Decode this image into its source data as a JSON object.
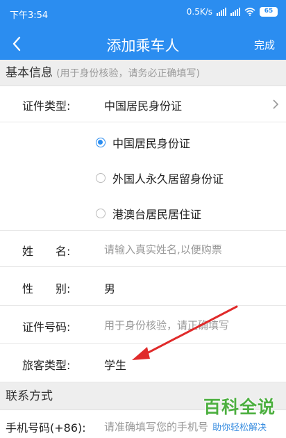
{
  "status_bar": {
    "time": "下午3:54",
    "speed": "0.5K/s",
    "battery": "65"
  },
  "nav": {
    "title": "添加乘车人",
    "done": "完成"
  },
  "basic_section": {
    "title": "基本信息",
    "hint": "(用于身份核验，请务必正确填写)"
  },
  "id_type": {
    "label": "证件类型:",
    "value": "中国居民身份证"
  },
  "id_options": [
    {
      "label": "中国居民身份证",
      "selected": true
    },
    {
      "label": "外国人永久居留身份证",
      "selected": false
    },
    {
      "label": "港澳台居民居住证",
      "selected": false
    }
  ],
  "name": {
    "label": "姓　　名:",
    "placeholder": "请输入真实姓名,以便购票"
  },
  "gender": {
    "label": "性　　别:",
    "value": "男"
  },
  "id_number": {
    "label": "证件号码:",
    "placeholder": "用于身份核验，请正确填写"
  },
  "passenger_type": {
    "label": "旅客类型:",
    "value": "学生"
  },
  "contact_section": {
    "title": "联系方式"
  },
  "phone": {
    "label": "手机号码(+86):",
    "placeholder": "请准确填写您的手机号"
  },
  "watermark": {
    "main": "百科全说",
    "sub": "助你轻松解决"
  },
  "colors": {
    "accent": "#2b8df0",
    "arrow": "#e02a2a",
    "watermark_green": "#4caf3f"
  }
}
